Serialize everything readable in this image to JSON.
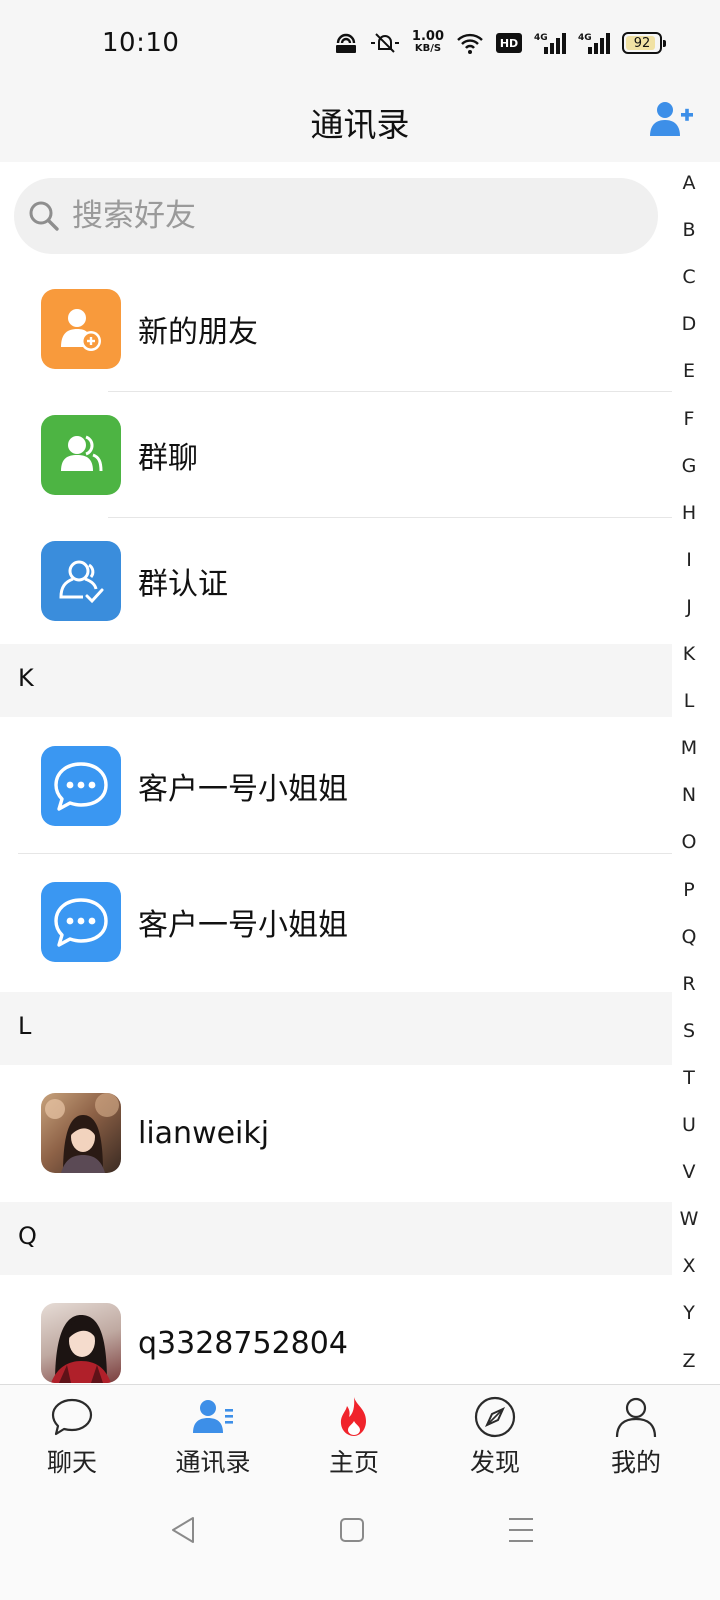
{
  "status_bar": {
    "time": "10:10",
    "network_speed": "1.00",
    "network_unit": "KB/S",
    "hd_label": "HD",
    "signal_type_1": "4G",
    "signal_type_2": "4G",
    "battery_level": "92",
    "battery_fraction": 0.92
  },
  "header": {
    "title": "通讯录",
    "add_icon": "add-contact-icon"
  },
  "search": {
    "placeholder": "搜索好友",
    "value": ""
  },
  "quick_entries": [
    {
      "label": "新的朋友",
      "icon": "new-friend-icon",
      "color": "#f89a3c"
    },
    {
      "label": "群聊",
      "icon": "group-chat-icon",
      "color": "#4db443"
    },
    {
      "label": "群认证",
      "icon": "group-verify-icon",
      "color": "#3a8ddc"
    }
  ],
  "sections": [
    {
      "letter": "K",
      "contacts": [
        {
          "name": "客户一号小姐姐",
          "avatar": "chat-bubble-icon"
        },
        {
          "name": "客户一号小姐姐",
          "avatar": "chat-bubble-icon"
        }
      ]
    },
    {
      "letter": "L",
      "contacts": [
        {
          "name": "lianweikj",
          "avatar": "photo-avatar"
        }
      ]
    },
    {
      "letter": "Q",
      "contacts": [
        {
          "name": "q3328752804",
          "avatar": "photo-avatar"
        }
      ]
    }
  ],
  "alphabet": [
    "A",
    "B",
    "C",
    "D",
    "E",
    "F",
    "G",
    "H",
    "I",
    "J",
    "K",
    "L",
    "M",
    "N",
    "O",
    "P",
    "Q",
    "R",
    "S",
    "T",
    "U",
    "V",
    "W",
    "X",
    "Y",
    "Z"
  ],
  "bottom_nav": [
    {
      "label": "聊天",
      "icon": "chat-icon"
    },
    {
      "label": "通讯录",
      "icon": "contacts-icon",
      "active": true
    },
    {
      "label": "主页",
      "icon": "flame-icon"
    },
    {
      "label": "发现",
      "icon": "compass-icon"
    },
    {
      "label": "我的",
      "icon": "profile-icon"
    }
  ],
  "colors": {
    "accent": "#3d8fe8",
    "flame": "#f0232b",
    "chat_tile": "#3a97f2"
  }
}
